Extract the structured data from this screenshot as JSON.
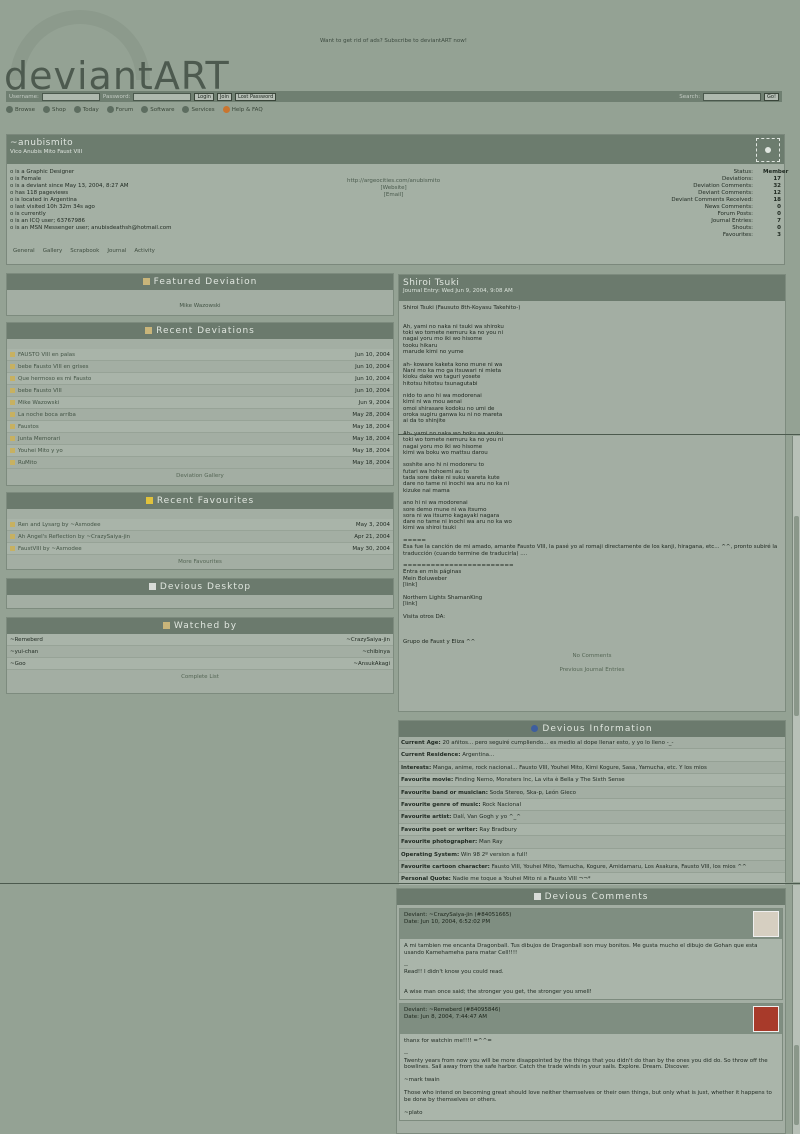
{
  "header": {
    "logo": "deviantART",
    "ads": "Want to get rid of ads? Subscribe to deviantART now!",
    "username_label": "Username:",
    "password_label": "Password:",
    "login": "Login",
    "join": "Join",
    "lost": "Lost Password",
    "search_label": "Search:",
    "go": "Go!"
  },
  "nav": [
    "Browse",
    "Shop",
    "Today",
    "Forum",
    "Software",
    "Services",
    "Help & FAQ"
  ],
  "profile": {
    "name": "~anubismito",
    "tagline": "Vico Anubis Mito Faust VIII",
    "facts": [
      "is a Graphic Designer",
      "is Female",
      "is a deviant since May 13, 2004, 8:27 AM",
      "has 118 pageviews",
      "is located in Argentina",
      "last visited 10h 32m 34s ago",
      "is currently",
      "is an ICQ user; 63767986",
      "is an MSN Messenger user; anubisdeathsh@hotmail.com"
    ],
    "website": "http://argeocities.com/anubismito",
    "website_label": "[Website]",
    "email_label": "[Email]",
    "stats": [
      [
        "Status:",
        "Member"
      ],
      [
        "Deviations:",
        "17"
      ],
      [
        "Deviation Comments:",
        "32"
      ],
      [
        "Deviant Comments:",
        "12"
      ],
      [
        "Deviant Comments Received:",
        "18"
      ],
      [
        "News Comments:",
        "0"
      ],
      [
        "Forum Posts:",
        "0"
      ],
      [
        "Journal Entries:",
        "7"
      ],
      [
        "Shouts:",
        "0"
      ],
      [
        "Favourites:",
        "3"
      ]
    ],
    "tabs": [
      "General",
      "Gallery",
      "Scrapbook",
      "Journal",
      "Activity"
    ]
  },
  "featured": {
    "title": "Featured Deviation",
    "item": "Mike Wazowski"
  },
  "recent": {
    "title": "Recent Deviations",
    "items": [
      [
        "FAUSTO VIII en palas",
        "Jun 10, 2004"
      ],
      [
        "bebe Fausto VIII en grises",
        "Jun 10, 2004"
      ],
      [
        "Que hermoso es mi Fausto",
        "Jun 10, 2004"
      ],
      [
        "bebe Fausto VIII",
        "Jun 10, 2004"
      ],
      [
        "Mike Wazowski",
        "Jun 9, 2004"
      ],
      [
        "La noche boca arriba",
        "May 28, 2004"
      ],
      [
        "Faustos",
        "May 18, 2004"
      ],
      [
        "Junta Memorari",
        "May 18, 2004"
      ],
      [
        "Youhei Mito y yo",
        "May 18, 2004"
      ],
      [
        "RuMito",
        "May 18, 2004"
      ]
    ],
    "footer": "Deviation Gallery"
  },
  "favourites": {
    "title": "Recent Favourites",
    "items": [
      [
        "Ren and Lysarg by ~Asmodee",
        "May 3, 2004"
      ],
      [
        "Ah Angel's Reflection by ~CrazySaiya-jin",
        "Apr 21, 2004"
      ],
      [
        "FaustVIII by ~Asmodee",
        "May 30, 2004"
      ]
    ],
    "footer": "More Favourites"
  },
  "desktop": {
    "title": "Devious Desktop"
  },
  "watched": {
    "title": "Watched by",
    "rows": [
      [
        "~Remeberd",
        "~CrazySaiya-jin"
      ],
      [
        "~yui-chan",
        "~chibinya"
      ],
      [
        "~Goo",
        "~AnsukAkagi"
      ]
    ],
    "footer": "Complete List"
  },
  "journal": {
    "title": "Shiroi Tsuki",
    "date": "Journal Entry: Wed Jun 9, 2004, 9:08 AM",
    "body": "Shiroi Tsuki (Fausuto 8th-Koyasu Takehito-)\n\n\nAh, yami no naka ni tsuki wa shiroku\ntoki wo tomete nemuru ka no you ni\nnagai yoru mo iki wo hisome\ntooku hikaru\nmarude kimi no yume\n\nah- koware kaketa kono mune ni wa\nNani mo ka mo ga itsuwari ni mieta\nkioku dake wo taguri yosete\nhitotsu hitotsu tsunagutabi\n\nnido to ano hi wa modorenai\nkimi ni wa mou aenai\nomoi shirasare kodoku no umi de\noroka sugiru ganwa ku ni no mareta\nai da to shinjite\n\nAh- yami no naka wo boku wa aruku\ntoki wo tomete nemuru ka no you ni\nnagai yoru mo iki wo hisome\nkimi wa boku wo mattsu darou\n\nsoshite ano hi ni modoreru to\nfutari wa hohoemi au to\ntada sore dake ni suku wareta kute\ndare no tame ni inochi wa aru no ka ni\nkizuke nai mama\n\nano hi ni wa modorenai\nsore demo mune ni wa itsumo\nsora ni wa itsumo kagayaki nagara\ndare no tame ni inochi wa aru no ka wo\nkimi wa shiroi tsuki\n\n=====\nEsa fue la canción de mi amado, amante Fausto VIII, la pasé yo al romaji directamente de los kanji, hiragana, etc... ^^, pronto subiré la traducción (cuando termine de traducirla) ....\n\n========================\nEntra en mis páginas\nMein Boluweber\n[link]\n\nNorthern Lights ShamanKing\n[link]\n\nVisita otros DA:\n\n\n\nGrupo de Faust y Eliza ^^",
    "no_comments": "No Comments",
    "prev": "Previous Journal Entries"
  },
  "info": {
    "title": "Devious Information",
    "rows": [
      [
        "Current Age:",
        "20 añitos... pero seguiré cumpliendo... es medio al dope llenar esto, y yo lo lleno -_-"
      ],
      [
        "Current Residence:",
        "Argentina..."
      ],
      [
        "Interests:",
        "Manga, anime, rock nacional... Fausto VIII, Youhei Mito, Kimi Kogure, Sasa, Yamucha, etc. Y los mios"
      ],
      [
        "Favourite movie:",
        "Finding Nemo, Monsters Inc, La vita è Bella y The Sixth Sense"
      ],
      [
        "Favourite band or musician:",
        "Soda Stereo, Ska-p, León Gieco"
      ],
      [
        "Favourite genre of music:",
        "Rock Nacional"
      ],
      [
        "Favourite artist:",
        "Dalí, Van Gogh y yo ^_^"
      ],
      [
        "Favourite poet or writer:",
        "Ray Bradbury"
      ],
      [
        "Favourite photographer:",
        "Man Ray"
      ],
      [
        "Operating System:",
        "Win 98 2º version a full!"
      ],
      [
        "Favourite cartoon character:",
        "Fausto VIII, Youhei Mito, Yamucha, Kogure, Amidamaru, Los Asakura, Fausto VIII, los mios ^^"
      ],
      [
        "Personal Quote:",
        "Nadie me toque a Youhei Mito ni a Fausto VIII ¬¬*"
      ]
    ]
  },
  "comments": {
    "title": "Devious Comments",
    "items": [
      {
        "head": "Deviant: ~CrazySaiya-jin (#84051665)\nDate: Jun 10, 2004, 6:52:02 PM",
        "body": "A mi tambien me encanta Dragonball. Tus dibujos de Dragonball son muy bonitos. Me gusta mucho el dibujo de Gohan que esta usando Kamehameha para matar Cell!!!!\n\n--\nRead!! I didn't know you could read.\n\n\nA wise man once said; the stronger you get, the stronger you smell!"
      },
      {
        "head": "Deviant: ~Remeberd (#84095846)\nDate: Jun 8, 2004, 7:44:47 AM",
        "body": "thanx for watchin me!!!! =^^=\n\n--\nTwenty years from now you will be more disappointed by the things that you didn't do than by the ones you did do. So throw off the bowlines. Sail away from the safe harbor. Catch the trade winds in your sails. Explore. Dream. Discover.\n\n~mark twain\n\nThose who intend on becoming great should love neither themselves or their own things, but only what is just, whether it happens to be done by themselves or others.\n\n~plato"
      }
    ]
  }
}
